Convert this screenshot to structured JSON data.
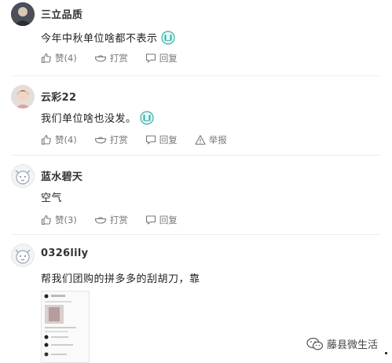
{
  "comments": [
    {
      "username": "三立品质",
      "text": "今年中秋单位啥都不表示",
      "emoji": "crying-emoji",
      "like_label": "赞(4)",
      "tip_label": "打赏",
      "reply_label": "回复"
    },
    {
      "username": "云彩22",
      "text": "我们单位啥也没发。",
      "emoji": "crying-emoji",
      "like_label": "赞(4)",
      "tip_label": "打赏",
      "reply_label": "回复",
      "report_label": "举报"
    },
    {
      "username": "蓝水碧天",
      "text": "空气",
      "like_label": "赞(3)",
      "tip_label": "打赏",
      "reply_label": "回复"
    },
    {
      "username": "0326lily",
      "text": "帮我们团购的拼多多的刮胡刀，靠"
    }
  ],
  "watermark": {
    "text": "藤县微生活"
  },
  "colors": {
    "text": "#222222",
    "muted": "#777777",
    "divider": "#ededed",
    "emoji": "#2bb3a6"
  }
}
